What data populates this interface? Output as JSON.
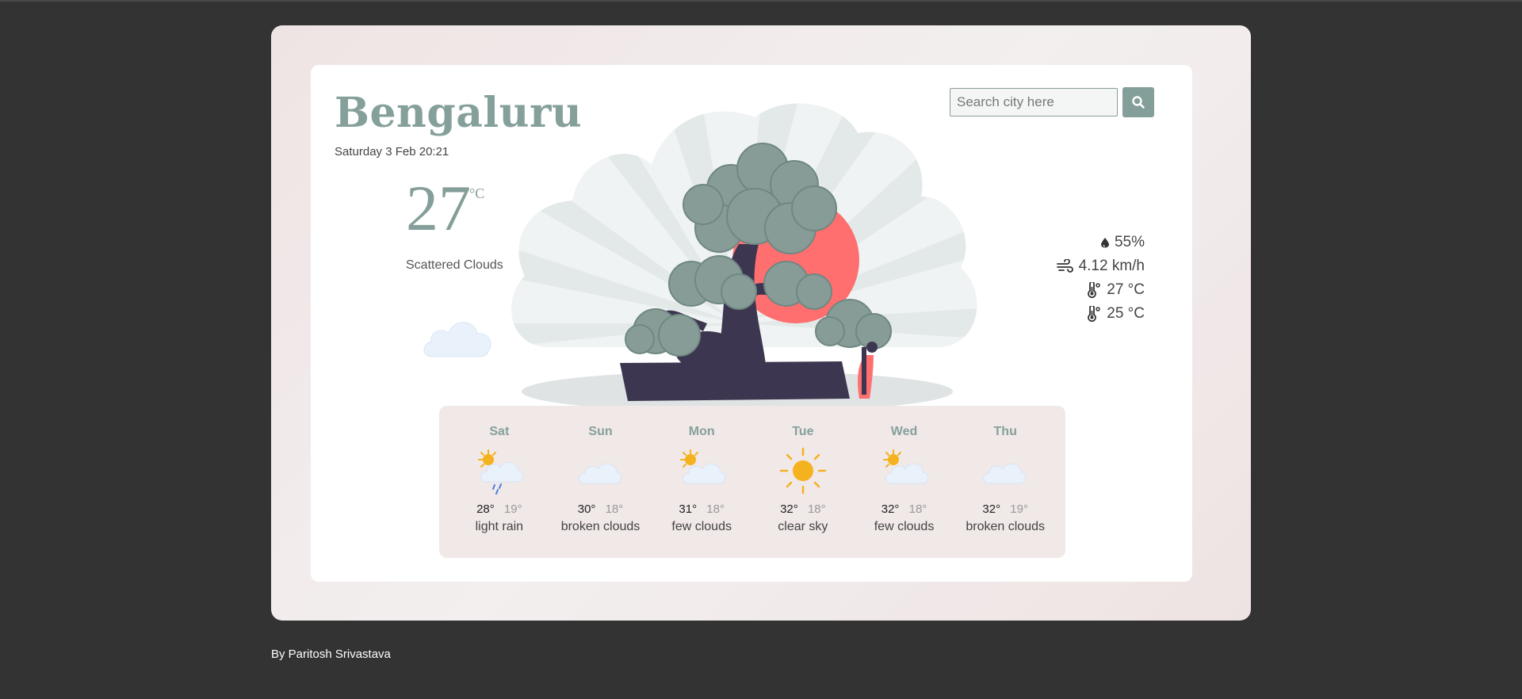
{
  "weather": {
    "city": "Bengaluru",
    "datetime": "Saturday 3 Feb 20:21",
    "temperature": "27",
    "unit": "°C",
    "condition": "Scattered Clouds",
    "condition_icon": "cloud-icon"
  },
  "search": {
    "placeholder": "Search city here",
    "value": "",
    "button_icon": "search-icon"
  },
  "stats": [
    {
      "icon": "humidity-drop-icon",
      "value": "55%"
    },
    {
      "icon": "wind-icon",
      "value": "4.12 km/h"
    },
    {
      "icon": "thermometer-icon",
      "value": "27 °C"
    },
    {
      "icon": "thermometer-icon",
      "value": "25 °C"
    }
  ],
  "forecast": [
    {
      "day": "Sat",
      "hi": "28°",
      "lo": "19°",
      "desc": "light rain",
      "icon": "sun-rain-cloud-icon"
    },
    {
      "day": "Sun",
      "hi": "30°",
      "lo": "18°",
      "desc": "broken clouds",
      "icon": "cloud-icon"
    },
    {
      "day": "Mon",
      "hi": "31°",
      "lo": "18°",
      "desc": "few clouds",
      "icon": "sun-cloud-icon"
    },
    {
      "day": "Tue",
      "hi": "32°",
      "lo": "18°",
      "desc": "clear sky",
      "icon": "sun-icon"
    },
    {
      "day": "Wed",
      "hi": "32°",
      "lo": "18°",
      "desc": "few clouds",
      "icon": "sun-cloud-icon"
    },
    {
      "day": "Thu",
      "hi": "32°",
      "lo": "19°",
      "desc": "broken clouds",
      "icon": "cloud-icon"
    }
  ],
  "footer": {
    "credit": "By Paritosh Srivastava"
  },
  "colors": {
    "accent": "#849e99",
    "sun": "#ff6f6f",
    "background": "#333333",
    "forecast_bg": "#f1e8e8"
  }
}
